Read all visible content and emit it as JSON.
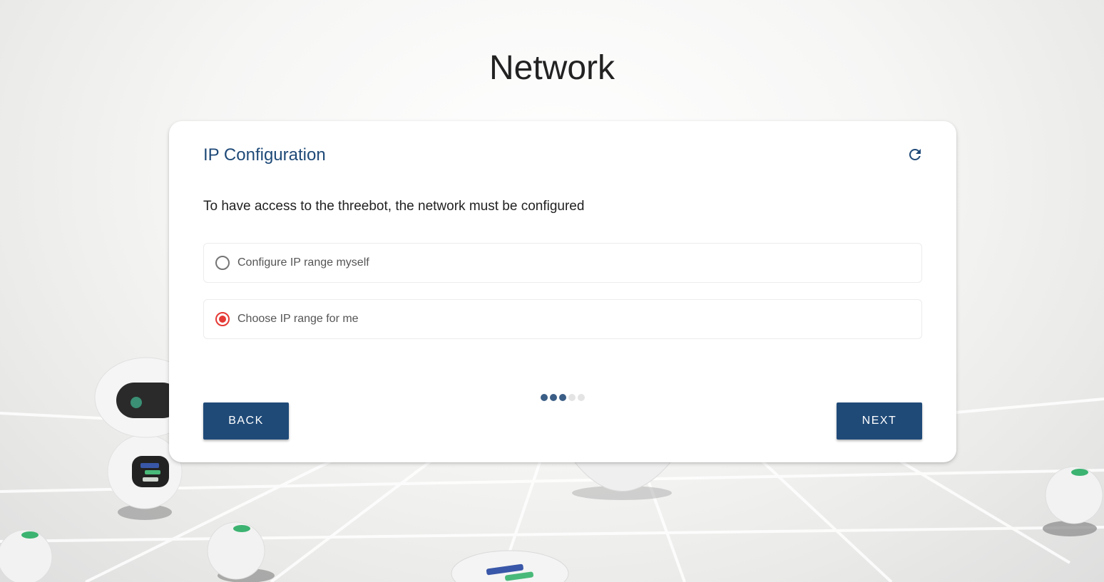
{
  "page": {
    "title": "Network"
  },
  "card": {
    "title": "IP Configuration",
    "description": "To have access to the threebot, the network must be configured",
    "refresh_icon": "refresh-icon",
    "options": [
      {
        "label": "Configure IP range myself",
        "selected": false
      },
      {
        "label": "Choose IP range for me",
        "selected": true
      }
    ],
    "steps": {
      "total": 5,
      "completed": 3
    },
    "back_label": "BACK",
    "next_label": "NEXT"
  },
  "colors": {
    "primary": "#1f4a78",
    "radio_selected": "#e53935",
    "title_text": "#222222"
  }
}
